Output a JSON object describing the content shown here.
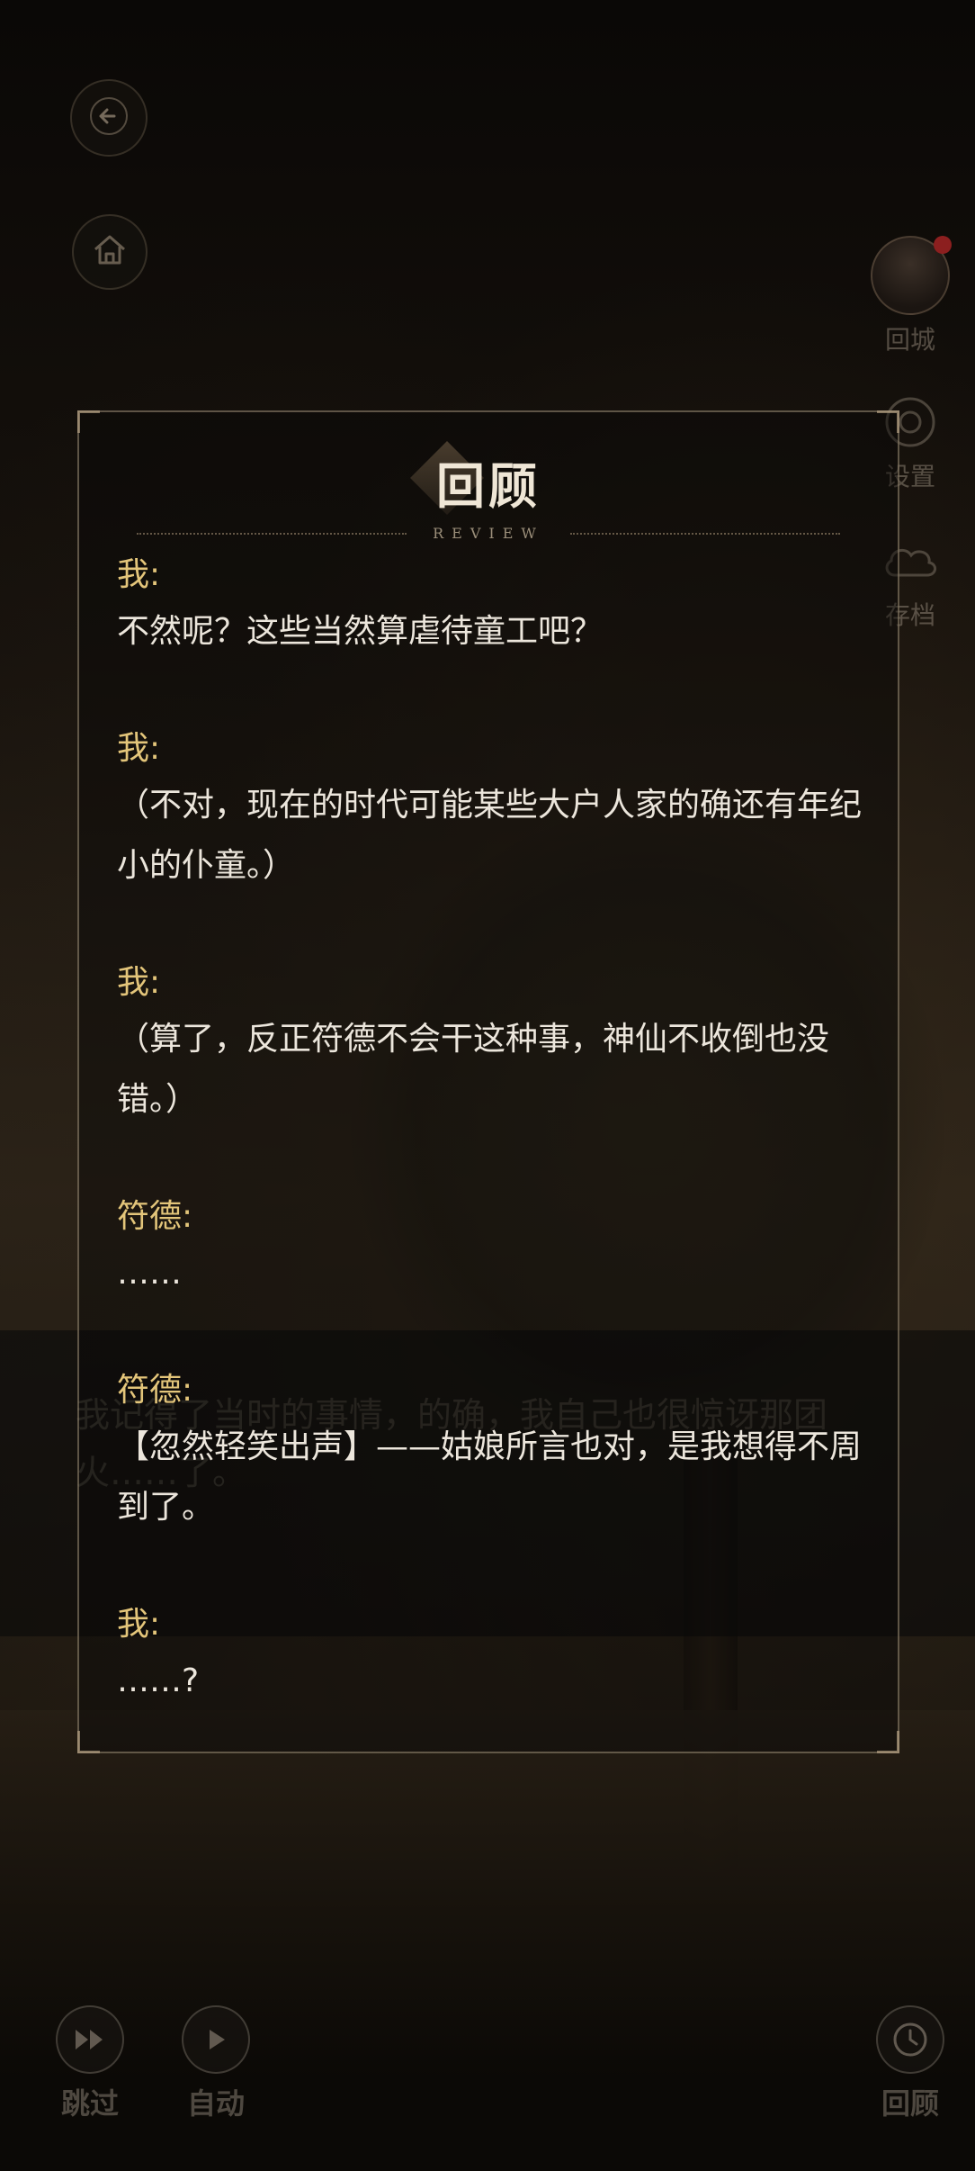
{
  "background": {
    "dialog_text": "我记得了当时的事情，的确，我自己也很惊讶那团火……了。"
  },
  "top_buttons": {
    "back_icon": "back-arrow-icon",
    "home_icon": "home-icon"
  },
  "side_menu": {
    "items": [
      {
        "label": "回城",
        "icon": "character-avatar"
      },
      {
        "label": "设置",
        "icon": "settings-icon"
      },
      {
        "label": "存档",
        "icon": "cloud-save-icon"
      }
    ]
  },
  "review": {
    "title": "回顾",
    "subtitle": "REVIEW",
    "entries": [
      {
        "speaker": "我:",
        "text": "不然呢？这些当然算虐待童工吧？"
      },
      {
        "speaker": "我:",
        "text": "（不对，现在的时代可能某些大户人家的确还有年纪小的仆童。）"
      },
      {
        "speaker": "我:",
        "text": "（算了，反正符德不会干这种事，神仙不收倒也没错。）"
      },
      {
        "speaker": "符德:",
        "text": "……"
      },
      {
        "speaker": "符德:",
        "text": "【忽然轻笑出声】——姑娘所言也对，是我想得不周到了。"
      },
      {
        "speaker": "我:",
        "text": "……?"
      }
    ]
  },
  "bottom_controls": {
    "skip_label": "跳过",
    "auto_label": "自动",
    "review_label": "回顾"
  },
  "colors": {
    "speaker": "#e3c57a",
    "text": "#ece6dc",
    "panel_border": "#a09178"
  }
}
